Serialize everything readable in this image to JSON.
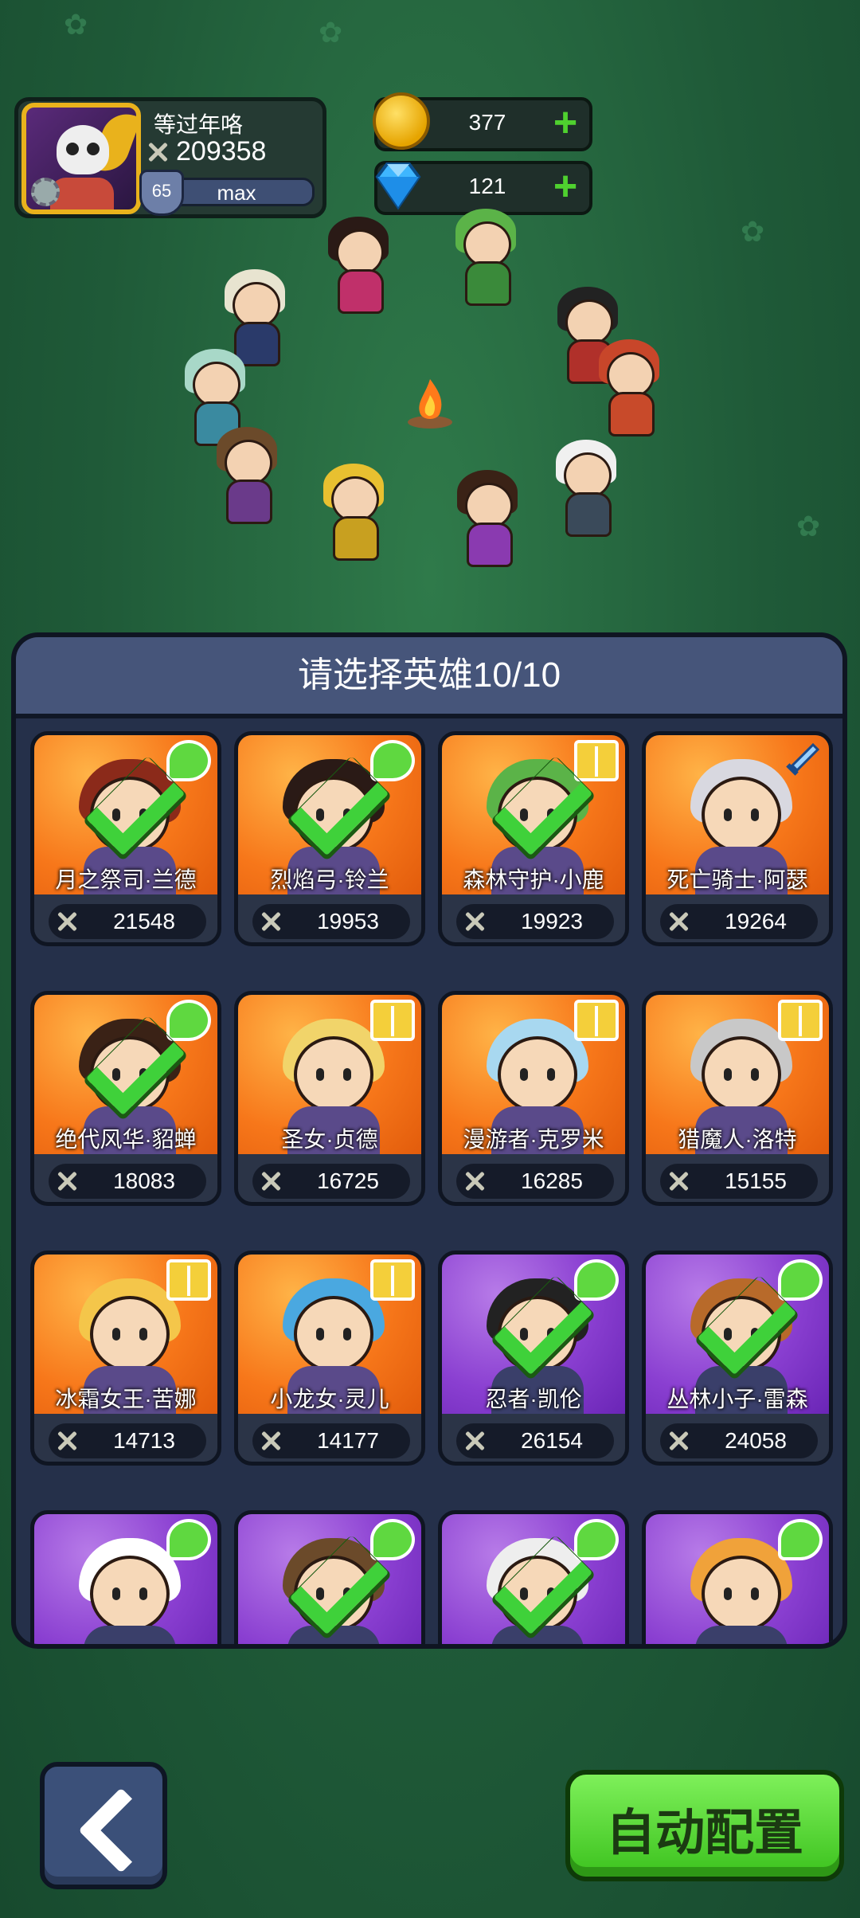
{
  "player": {
    "name": "等过年咯",
    "power": "209358",
    "level": "65",
    "level_status": "max"
  },
  "currency": {
    "gold": "377",
    "gems": "121"
  },
  "panel": {
    "title": "请选择英雄10/10"
  },
  "heroes": [
    {
      "name": "月之祭司·兰德",
      "power": "21548",
      "selected": true,
      "bg": "orange",
      "badge": "leaf"
    },
    {
      "name": "烈焰弓·铃兰",
      "power": "19953",
      "selected": true,
      "bg": "orange",
      "badge": "leaf"
    },
    {
      "name": "森林守护·小鹿",
      "power": "19923",
      "selected": true,
      "bg": "orange",
      "badge": "book"
    },
    {
      "name": "死亡骑士·阿瑟",
      "power": "19264",
      "selected": false,
      "bg": "orange",
      "badge": "sword"
    },
    {
      "name": "绝代风华·貂蝉",
      "power": "18083",
      "selected": true,
      "bg": "orange",
      "badge": "leaf"
    },
    {
      "name": "圣女·贞德",
      "power": "16725",
      "selected": false,
      "bg": "orange",
      "badge": "book"
    },
    {
      "name": "漫游者·克罗米",
      "power": "16285",
      "selected": false,
      "bg": "orange",
      "badge": "book"
    },
    {
      "name": "猎魔人·洛特",
      "power": "15155",
      "selected": false,
      "bg": "orange",
      "badge": "book"
    },
    {
      "name": "冰霜女王·苦娜",
      "power": "14713",
      "selected": false,
      "bg": "orange",
      "badge": "book"
    },
    {
      "name": "小龙女·灵儿",
      "power": "14177",
      "selected": false,
      "bg": "orange",
      "badge": "book"
    },
    {
      "name": "忍者·凯伦",
      "power": "26154",
      "selected": true,
      "bg": "purple",
      "badge": "leaf"
    },
    {
      "name": "丛林小子·雷森",
      "power": "24058",
      "selected": true,
      "bg": "purple",
      "badge": "leaf"
    },
    {
      "name": "",
      "power": "",
      "selected": false,
      "bg": "purple",
      "badge": "leaf"
    },
    {
      "name": "",
      "power": "",
      "selected": true,
      "bg": "purple",
      "badge": "leaf"
    },
    {
      "name": "",
      "power": "",
      "selected": true,
      "bg": "purple",
      "badge": "leaf"
    },
    {
      "name": "",
      "power": "",
      "selected": false,
      "bg": "purple",
      "badge": "leaf"
    }
  ],
  "buttons": {
    "auto": "自动配置"
  },
  "colors": {
    "gold_card": "#f7771a",
    "purple_card": "#8a3fd1",
    "check": "#3fd13a",
    "auto_button": "#4fd12f"
  }
}
